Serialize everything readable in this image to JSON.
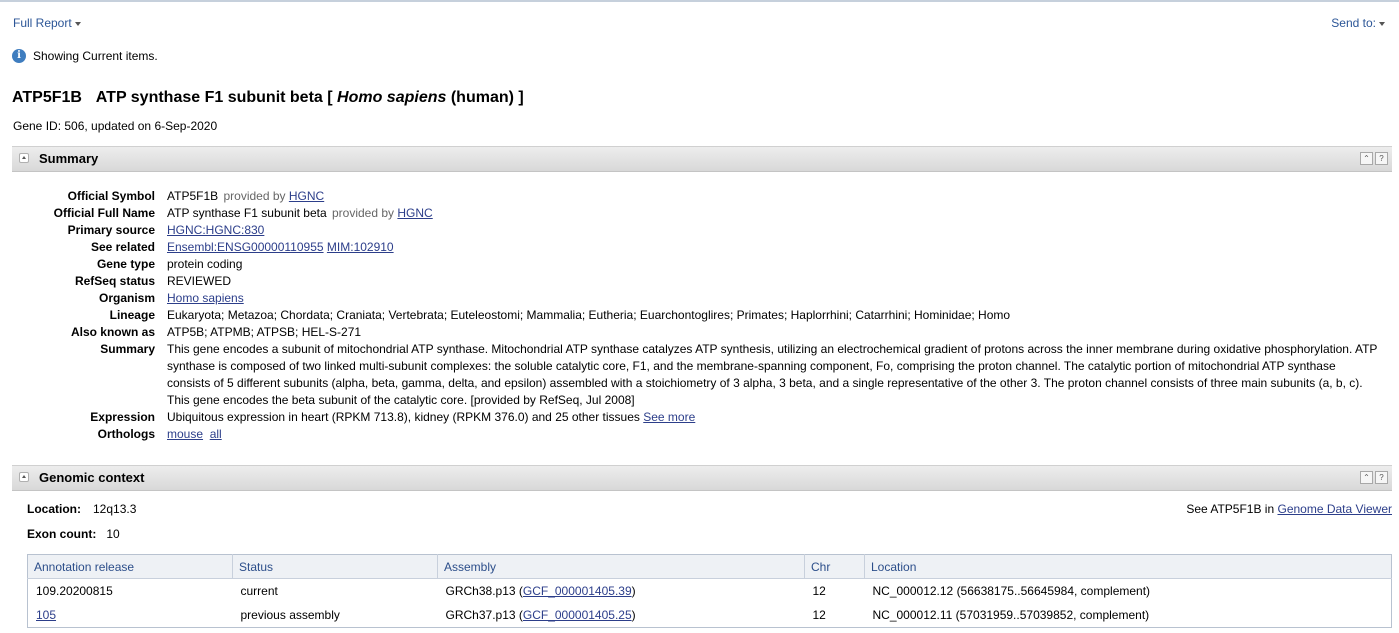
{
  "topbar": {
    "full_report": "Full Report",
    "send_to": "Send to:"
  },
  "notice": {
    "text": "Showing Current items."
  },
  "gene": {
    "symbol": "ATP5F1B",
    "name_prefix": "ATP synthase F1 subunit beta [",
    "organism_italic": "Homo sapiens",
    "name_suffix": "(human) ]",
    "gene_id_line": "Gene ID: 506, updated on 6-Sep-2020"
  },
  "summary_section": {
    "title": "Summary",
    "official_symbol": {
      "label": "Official Symbol",
      "value": "ATP5F1B",
      "provided": "provided by",
      "link": "HGNC"
    },
    "official_full_name": {
      "label": "Official Full Name",
      "value": "ATP synthase F1 subunit beta",
      "provided": "provided by",
      "link": "HGNC"
    },
    "primary_source": {
      "label": "Primary source",
      "link": "HGNC:HGNC:830"
    },
    "see_related": {
      "label": "See related",
      "link1": "Ensembl:ENSG00000110955",
      "link2": "MIM:102910"
    },
    "gene_type": {
      "label": "Gene type",
      "value": "protein coding"
    },
    "refseq_status": {
      "label": "RefSeq status",
      "value": "REVIEWED"
    },
    "organism": {
      "label": "Organism",
      "link": "Homo sapiens"
    },
    "lineage": {
      "label": "Lineage",
      "value": "Eukaryota; Metazoa; Chordata; Craniata; Vertebrata; Euteleostomi; Mammalia; Eutheria; Euarchontoglires; Primates; Haplorrhini; Catarrhini; Hominidae; Homo"
    },
    "also_known_as": {
      "label": "Also known as",
      "value": "ATP5B; ATPMB; ATPSB; HEL-S-271"
    },
    "summary": {
      "label": "Summary",
      "value": "This gene encodes a subunit of mitochondrial ATP synthase. Mitochondrial ATP synthase catalyzes ATP synthesis, utilizing an electrochemical gradient of protons across the inner membrane during oxidative phosphorylation. ATP synthase is composed of two linked multi-subunit complexes: the soluble catalytic core, F1, and the membrane-spanning component, Fo, comprising the proton channel. The catalytic portion of mitochondrial ATP synthase consists of 5 different subunits (alpha, beta, gamma, delta, and epsilon) assembled with a stoichiometry of 3 alpha, 3 beta, and a single representative of the other 3. The proton channel consists of three main subunits (a, b, c). This gene encodes the beta subunit of the catalytic core. [provided by RefSeq, Jul 2008]"
    },
    "expression": {
      "label": "Expression",
      "value": "Ubiquitous expression in heart (RPKM 713.8), kidney (RPKM 376.0) and 25 other tissues",
      "link": "See more"
    },
    "orthologs": {
      "label": "Orthologs",
      "link1": "mouse",
      "link2": "all"
    }
  },
  "genomic_section": {
    "title": "Genomic context",
    "location_label": "Location:",
    "location_value": "12q13.3",
    "exon_label": "Exon count:",
    "exon_value": "10",
    "see_prefix": "See ATP5F1B in",
    "gdv_link": "Genome Data Viewer",
    "columns": [
      "Annotation release",
      "Status",
      "Assembly",
      "Chr",
      "Location"
    ],
    "rows": [
      {
        "release": "109.20200815",
        "status": "current",
        "assembly": "GRCh38.p13 (",
        "assembly_link": "GCF_000001405.39",
        "assembly_end": ")",
        "chr": "12",
        "location": "NC_000012.12 (56638175..56645984, complement)"
      },
      {
        "release": "105",
        "status": "previous assembly",
        "assembly": "GRCh37.p13 (",
        "assembly_link": "GCF_000001405.25",
        "assembly_end": ")",
        "chr": "12",
        "location": "NC_000012.11 (57031959..57039852, complement)"
      }
    ]
  }
}
